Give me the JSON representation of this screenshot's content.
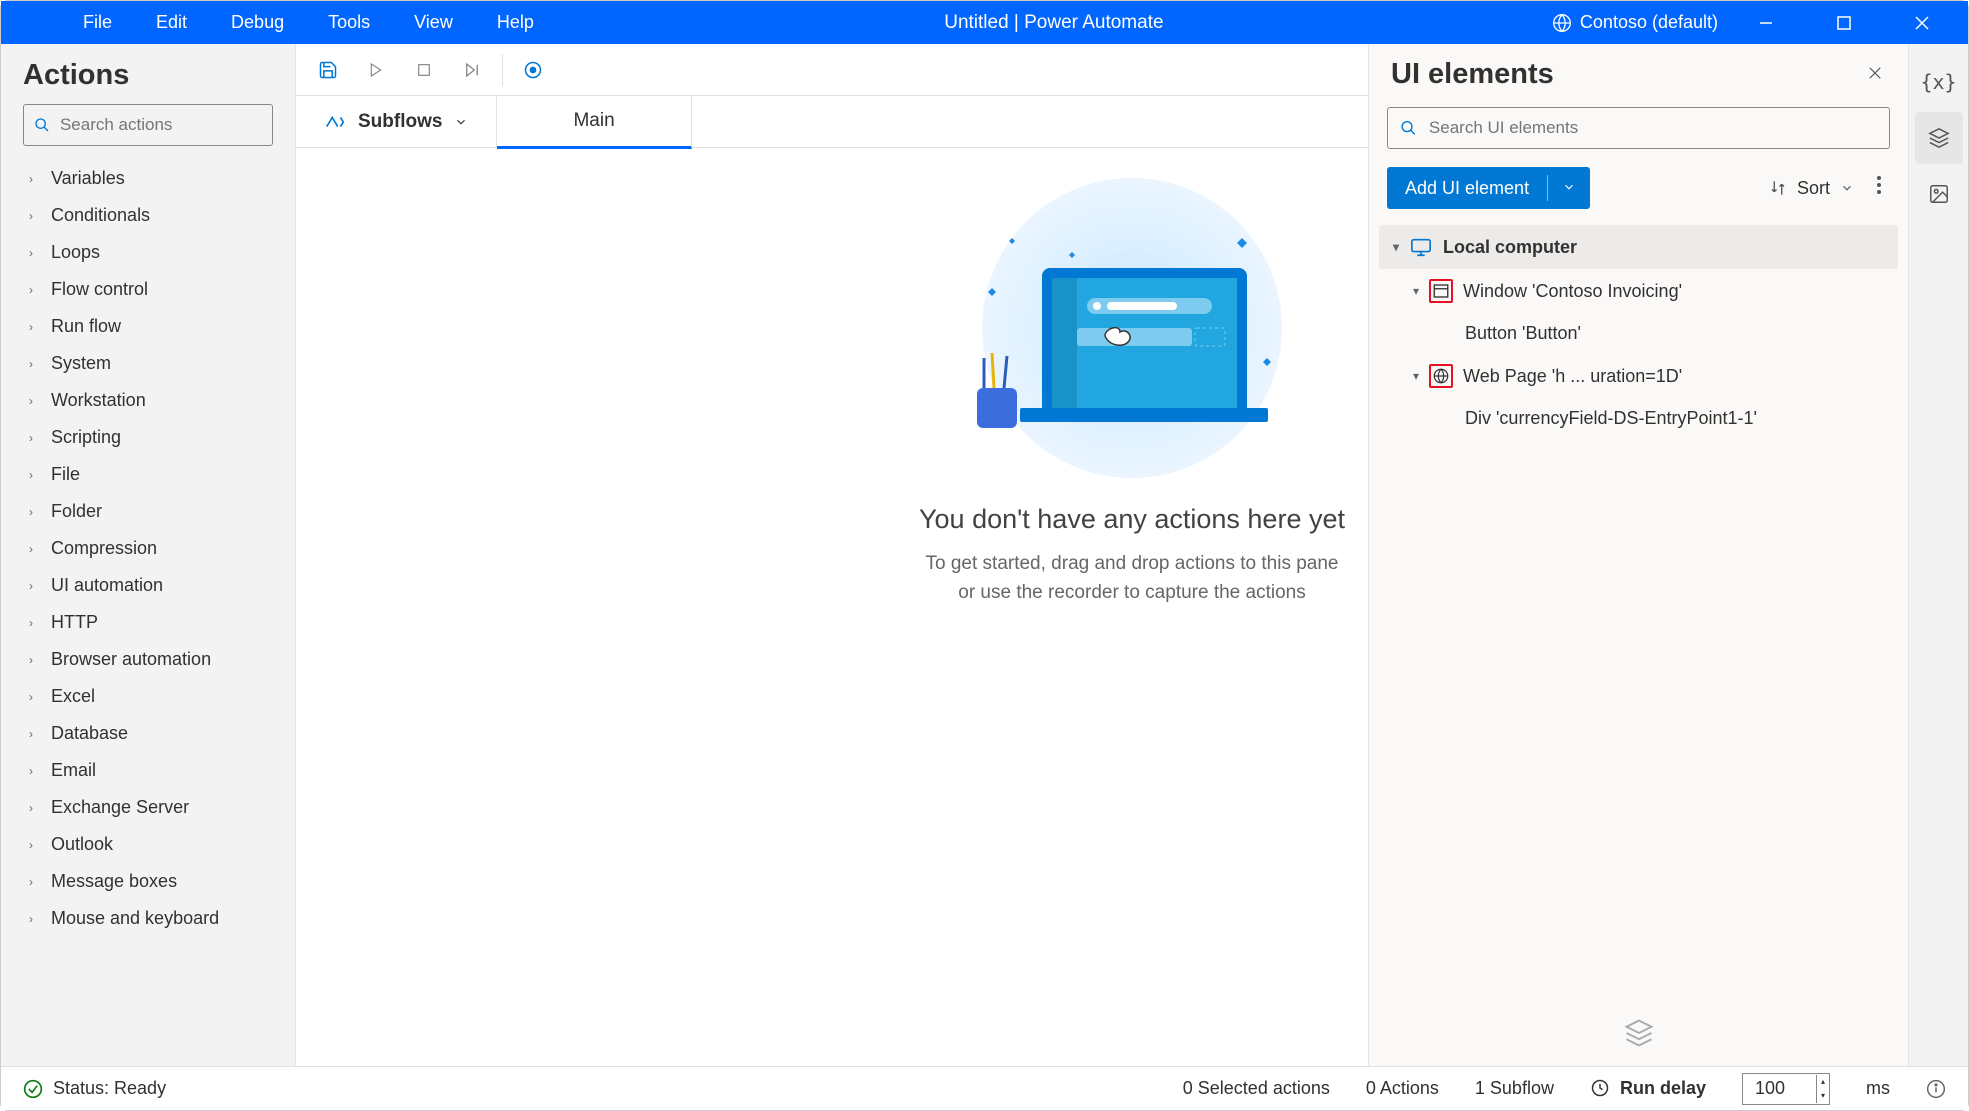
{
  "title_bar": {
    "menus": [
      "File",
      "Edit",
      "Debug",
      "Tools",
      "View",
      "Help"
    ],
    "title": "Untitled | Power Automate",
    "workspace": "Contoso (default)"
  },
  "actions_panel": {
    "title": "Actions",
    "search_placeholder": "Search actions",
    "items": [
      "Variables",
      "Conditionals",
      "Loops",
      "Flow control",
      "Run flow",
      "System",
      "Workstation",
      "Scripting",
      "File",
      "Folder",
      "Compression",
      "UI automation",
      "HTTP",
      "Browser automation",
      "Excel",
      "Database",
      "Email",
      "Exchange Server",
      "Outlook",
      "Message boxes",
      "Mouse and keyboard"
    ]
  },
  "subflows_label": "Subflows",
  "main_tab": "Main",
  "empty": {
    "title": "You don't have any actions here yet",
    "line1": "To get started, drag and drop actions to this pane",
    "line2": "or use the recorder to capture the actions"
  },
  "right_panel": {
    "title": "UI elements",
    "search_placeholder": "Search UI elements",
    "add_label": "Add UI element",
    "sort_label": "Sort",
    "tree": {
      "root": "Local computer",
      "window": "Window 'Contoso Invoicing'",
      "button": "Button 'Button'",
      "webpage": "Web Page 'h ... uration=1D'",
      "div": "Div 'currencyField-DS-EntryPoint1-1'"
    }
  },
  "status": {
    "ready": "Status: Ready",
    "selected": "0 Selected actions",
    "actions": "0 Actions",
    "subflows": "1 Subflow",
    "run_delay": "Run delay",
    "delay_value": "100",
    "delay_unit": "ms"
  }
}
